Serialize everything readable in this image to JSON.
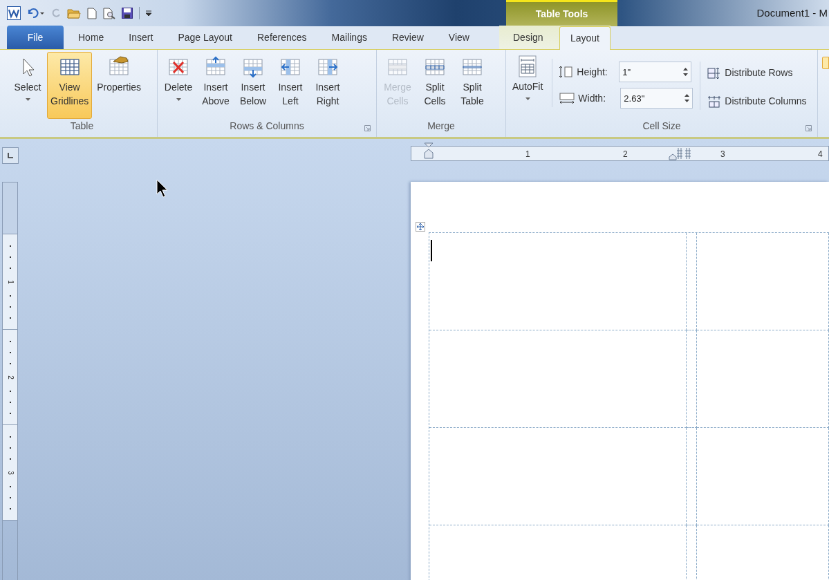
{
  "window": {
    "title": "Document1 - M"
  },
  "contextual_tab_group": {
    "title": "Table Tools"
  },
  "tabs": [
    {
      "label": "File",
      "kind": "file",
      "selected": false
    },
    {
      "label": "Home",
      "kind": "normal",
      "selected": false
    },
    {
      "label": "Insert",
      "kind": "normal",
      "selected": false
    },
    {
      "label": "Page Layout",
      "kind": "normal",
      "selected": false
    },
    {
      "label": "References",
      "kind": "normal",
      "selected": false
    },
    {
      "label": "Mailings",
      "kind": "normal",
      "selected": false
    },
    {
      "label": "Review",
      "kind": "normal",
      "selected": false
    },
    {
      "label": "View",
      "kind": "normal",
      "selected": false
    },
    {
      "label": "Design",
      "kind": "contextual",
      "selected": false
    },
    {
      "label": "Layout",
      "kind": "contextual",
      "selected": true
    }
  ],
  "ribbon_groups": [
    {
      "name": "Table",
      "buttons": [
        {
          "kind": "select",
          "lines": [
            "Select"
          ],
          "dropdown": true,
          "selected": false,
          "disabled": false
        },
        {
          "kind": "gridlines",
          "lines": [
            "View",
            "Gridlines"
          ],
          "dropdown": false,
          "selected": true,
          "disabled": false
        },
        {
          "kind": "properties",
          "lines": [
            "Properties"
          ],
          "dropdown": false,
          "selected": false,
          "disabled": false
        }
      ]
    },
    {
      "name": "Rows & Columns",
      "buttons": [
        {
          "kind": "delete",
          "lines": [
            "Delete"
          ],
          "dropdown": true,
          "selected": false,
          "disabled": false
        },
        {
          "kind": "above",
          "lines": [
            "Insert",
            "Above"
          ],
          "dropdown": false,
          "selected": false,
          "disabled": false
        },
        {
          "kind": "below",
          "lines": [
            "Insert",
            "Below"
          ],
          "dropdown": false,
          "selected": false,
          "disabled": false
        },
        {
          "kind": "left",
          "lines": [
            "Insert",
            "Left"
          ],
          "dropdown": false,
          "selected": false,
          "disabled": false
        },
        {
          "kind": "right",
          "lines": [
            "Insert",
            "Right"
          ],
          "dropdown": false,
          "selected": false,
          "disabled": false
        }
      ]
    },
    {
      "name": "Merge",
      "buttons": [
        {
          "kind": "merge",
          "lines": [
            "Merge",
            "Cells"
          ],
          "dropdown": false,
          "selected": false,
          "disabled": true
        },
        {
          "kind": "split_cells",
          "lines": [
            "Split",
            "Cells"
          ],
          "dropdown": false,
          "selected": false,
          "disabled": false
        },
        {
          "kind": "split_table",
          "lines": [
            "Split",
            "Table"
          ],
          "dropdown": false,
          "selected": false,
          "disabled": false
        }
      ]
    }
  ],
  "cell_size": {
    "name": "Cell Size",
    "autofit": {
      "label": "AutoFit"
    },
    "height": {
      "label": "Height:",
      "value": "1\""
    },
    "width": {
      "label": "Width:",
      "value": "2.63\""
    },
    "distribute_rows": "Distribute Rows",
    "distribute_columns": "Distribute Columns"
  },
  "horizontal_ruler": {
    "numbers": [
      "1",
      "2",
      "3",
      "4"
    ]
  },
  "vertical_ruler": {
    "numbers": [
      "1",
      "2",
      "3"
    ]
  }
}
